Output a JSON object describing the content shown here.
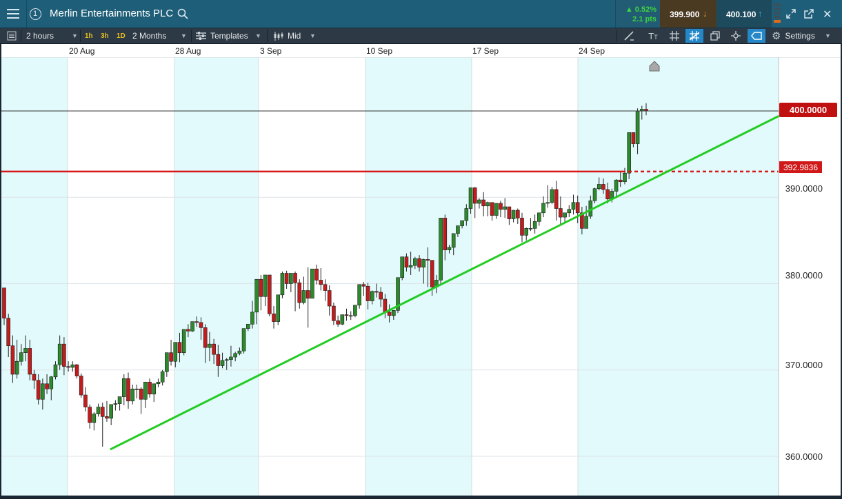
{
  "window": {
    "title": "Merlin Entertainments PLC",
    "change_pct": "▲ 0.52%",
    "change_pts": "2.1 pts",
    "sell_price": "399.900",
    "buy_price": "400.100",
    "up_color": "#3fd43f",
    "sell_color": "#e39a2c",
    "buy_color": "#2fb4e0"
  },
  "toolbar": {
    "interval": "2 hours",
    "quick_tf": [
      "1h",
      "3h",
      "1D"
    ],
    "range": "2 Months",
    "templates_label": "Templates",
    "price_mode": "Mid",
    "settings_label": "Settings",
    "icons": [
      "list-icon",
      "draw-line-icon",
      "text-tool-icon",
      "grid-icon",
      "trendline-tool-icon",
      "layers-icon",
      "crosshair-icon",
      "tag-icon",
      "gear-icon"
    ]
  },
  "chart_data": {
    "type": "candlestick",
    "title": "",
    "instrument": "Merlin Entertainments PLC",
    "xlabel": "",
    "ylabel": "",
    "date_labels": [
      "20 Aug",
      "28 Aug",
      "3 Sep",
      "10 Sep",
      "17 Sep",
      "24 Sep"
    ],
    "y_ticks": [
      360,
      370,
      380,
      390,
      400
    ],
    "y_tick_labels": [
      "360.0000",
      "370.0000",
      "380.0000",
      "390.0000"
    ],
    "ylim": [
      356.0,
      405.6
    ],
    "last_price": 400.0,
    "last_price_label": "400.0000",
    "horizontal_level": 392.9836,
    "horizontal_level_label": "392.9836",
    "trendline": {
      "from_price": 360.8,
      "to_price": 399.4,
      "color": "#22cc22"
    },
    "level_color": "#d81818",
    "up_color": "#2c8a2c",
    "down_color": "#c41c1c",
    "grid": true,
    "candles": [
      [
        379.5,
        379.5,
        376.0,
        375.2
      ],
      [
        376.0,
        376.5,
        372.8,
        371.5
      ],
      [
        372.8,
        374.0,
        369.5,
        368.5
      ],
      [
        369.5,
        373.5,
        371.0,
        369.0
      ],
      [
        371.0,
        373.0,
        372.0,
        370.5
      ],
      [
        372.0,
        374.0,
        372.5,
        371.0
      ],
      [
        372.5,
        373.5,
        369.5,
        368.8
      ],
      [
        369.5,
        370.0,
        368.8,
        367.8
      ],
      [
        368.8,
        369.5,
        366.6,
        366.0
      ],
      [
        366.6,
        369.0,
        368.4,
        365.4
      ],
      [
        368.4,
        369.5,
        367.8,
        367.2
      ],
      [
        367.8,
        369.3,
        369.2,
        366.5
      ],
      [
        369.2,
        371.0,
        370.6,
        368.9
      ],
      [
        370.6,
        374.0,
        373.0,
        370.0
      ],
      [
        373.0,
        373.8,
        370.4,
        369.4
      ],
      [
        370.4,
        371.0,
        370.3,
        369.8
      ],
      [
        370.3,
        371.0,
        370.6,
        369.8
      ],
      [
        370.6,
        370.7,
        369.3,
        369.0
      ],
      [
        369.3,
        369.6,
        367.1,
        366.8
      ],
      [
        367.1,
        368.0,
        365.7,
        365.2
      ],
      [
        365.7,
        366.0,
        363.9,
        363.2
      ],
      [
        363.9,
        365.1,
        364.9,
        363.0
      ],
      [
        364.9,
        366.1,
        365.7,
        364.6
      ],
      [
        365.7,
        366.2,
        364.6,
        361.1
      ],
      [
        364.6,
        366.4,
        364.4,
        364.0
      ],
      [
        364.4,
        365.8,
        366.0,
        363.6
      ],
      [
        366.0,
        366.5,
        366.1,
        365.3
      ],
      [
        366.1,
        366.8,
        366.9,
        365.3
      ],
      [
        366.9,
        369.5,
        369.0,
        365.9
      ],
      [
        369.0,
        369.7,
        366.4,
        365.5
      ],
      [
        366.4,
        368.3,
        367.8,
        366.0
      ],
      [
        367.8,
        368.3,
        367.8,
        366.7
      ],
      [
        367.8,
        368.0,
        366.6,
        364.9
      ],
      [
        366.6,
        368.3,
        368.6,
        365.6
      ],
      [
        368.6,
        369.0,
        367.2,
        366.8
      ],
      [
        367.2,
        368.4,
        368.4,
        366.3
      ],
      [
        368.4,
        369.0,
        368.6,
        368.0
      ],
      [
        368.6,
        370.0,
        369.8,
        368.2
      ],
      [
        369.8,
        371.3,
        372.0,
        369.2
      ],
      [
        372.0,
        373.5,
        371.0,
        370.5
      ],
      [
        371.0,
        373.1,
        373.2,
        370.3
      ],
      [
        373.2,
        374.3,
        372.0,
        370.9
      ],
      [
        372.0,
        374.1,
        374.7,
        371.7
      ],
      [
        374.7,
        375.3,
        374.5,
        373.8
      ],
      [
        374.5,
        375.2,
        375.6,
        374.4
      ],
      [
        375.6,
        376.2,
        375.5,
        375.0
      ],
      [
        375.5,
        376.1,
        374.9,
        373.5
      ],
      [
        374.9,
        375.3,
        372.6,
        370.8
      ],
      [
        372.6,
        374.4,
        373.0,
        371.0
      ],
      [
        373.0,
        373.6,
        371.8,
        370.7
      ],
      [
        371.8,
        372.9,
        370.5,
        369.2
      ],
      [
        370.5,
        372.0,
        371.1,
        370.2
      ],
      [
        371.1,
        371.4,
        371.2,
        370.0
      ],
      [
        371.2,
        372.8,
        371.5,
        370.4
      ],
      [
        371.5,
        372.1,
        371.9,
        371.0
      ],
      [
        371.9,
        372.6,
        372.2,
        371.7
      ],
      [
        372.2,
        374.1,
        374.8,
        371.9
      ],
      [
        374.8,
        375.1,
        375.3,
        374.5
      ],
      [
        375.3,
        378.0,
        376.7,
        374.8
      ],
      [
        376.7,
        378.3,
        380.5,
        375.3
      ],
      [
        380.5,
        381.0,
        378.5,
        376.9
      ],
      [
        378.5,
        380.9,
        381.0,
        377.4
      ],
      [
        381.0,
        380.7,
        376.5,
        376.2
      ],
      [
        376.5,
        377.4,
        375.6,
        374.8
      ],
      [
        375.6,
        378.5,
        378.7,
        375.2
      ],
      [
        378.7,
        381.4,
        381.2,
        378.3
      ],
      [
        381.2,
        381.5,
        380.0,
        379.4
      ],
      [
        380.0,
        380.5,
        381.2,
        379.0
      ],
      [
        381.2,
        381.4,
        380.1,
        376.8
      ],
      [
        380.1,
        380.5,
        377.8,
        377.1
      ],
      [
        377.8,
        380.8,
        379.2,
        377.6
      ],
      [
        379.2,
        381.9,
        378.3,
        374.9
      ],
      [
        378.3,
        379.3,
        381.7,
        378.5
      ],
      [
        381.7,
        382.2,
        380.4,
        379.9
      ],
      [
        380.4,
        381.8,
        379.9,
        379.2
      ],
      [
        379.9,
        380.5,
        379.2,
        378.0
      ],
      [
        379.2,
        379.8,
        377.4,
        376.3
      ],
      [
        377.4,
        377.8,
        375.7,
        375.2
      ],
      [
        375.7,
        376.3,
        375.3,
        375.0
      ],
      [
        375.3,
        376.0,
        376.4,
        375.2
      ],
      [
        376.4,
        377.1,
        376.3,
        375.7
      ],
      [
        376.3,
        376.8,
        376.3,
        375.8
      ],
      [
        376.3,
        377.5,
        377.5,
        376.1
      ],
      [
        377.5,
        379.2,
        379.9,
        377.1
      ],
      [
        379.9,
        380.2,
        379.7,
        378.6
      ],
      [
        379.7,
        380.1,
        378.0,
        377.0
      ],
      [
        378.0,
        379.2,
        379.1,
        377.6
      ],
      [
        379.1,
        380.0,
        379.0,
        378.4
      ],
      [
        379.0,
        379.6,
        378.2,
        377.3
      ],
      [
        378.2,
        378.8,
        376.7,
        376.0
      ],
      [
        376.7,
        377.6,
        376.3,
        375.5
      ],
      [
        376.3,
        376.7,
        376.9,
        375.8
      ],
      [
        376.9,
        377.7,
        380.7,
        376.6
      ],
      [
        380.7,
        383.1,
        383.1,
        380.4
      ],
      [
        383.1,
        383.5,
        381.9,
        381.4
      ],
      [
        381.9,
        383.7,
        382.1,
        381.0
      ],
      [
        382.1,
        383.1,
        382.9,
        381.7
      ],
      [
        382.9,
        383.3,
        381.9,
        381.4
      ],
      [
        381.9,
        382.9,
        382.8,
        380.0
      ],
      [
        382.8,
        384.2,
        382.7,
        379.6
      ],
      [
        382.7,
        381.7,
        379.6,
        378.6
      ],
      [
        379.6,
        381.0,
        380.4,
        378.9
      ],
      [
        380.4,
        381.9,
        387.6,
        379.9
      ],
      [
        387.6,
        388.0,
        383.9,
        382.7
      ],
      [
        383.9,
        384.5,
        384.2,
        383.5
      ],
      [
        384.2,
        385.4,
        385.8,
        383.3
      ],
      [
        385.8,
        386.5,
        386.7,
        385.4
      ],
      [
        386.7,
        387.1,
        387.3,
        386.4
      ],
      [
        387.3,
        389.2,
        388.7,
        386.7
      ],
      [
        388.7,
        390.0,
        391.1,
        388.1
      ],
      [
        391.1,
        391.2,
        389.3,
        387.6
      ],
      [
        389.3,
        389.9,
        389.7,
        388.7
      ],
      [
        389.7,
        390.6,
        389.0,
        387.8
      ],
      [
        389.0,
        389.5,
        389.4,
        387.8
      ],
      [
        389.4,
        389.2,
        387.9,
        387.3
      ],
      [
        387.9,
        388.9,
        389.3,
        387.5
      ],
      [
        389.3,
        389.6,
        388.6,
        387.7
      ],
      [
        388.6,
        389.9,
        388.9,
        387.6
      ],
      [
        388.9,
        388.7,
        387.5,
        386.8
      ],
      [
        387.5,
        388.5,
        388.5,
        387.1
      ],
      [
        388.5,
        388.7,
        387.6,
        386.9
      ],
      [
        387.6,
        388.2,
        385.6,
        384.8
      ],
      [
        385.6,
        386.5,
        386.4,
        385.0
      ],
      [
        386.4,
        387.6,
        386.4,
        386.1
      ],
      [
        386.4,
        388.0,
        387.2,
        385.8
      ],
      [
        387.2,
        387.9,
        388.2,
        386.7
      ],
      [
        388.2,
        390.1,
        389.3,
        387.7
      ],
      [
        389.3,
        391.4,
        389.4,
        388.8
      ],
      [
        389.4,
        391.2,
        390.9,
        389.2
      ],
      [
        390.9,
        391.9,
        388.7,
        387.3
      ],
      [
        388.7,
        390.1,
        387.7,
        386.9
      ],
      [
        387.7,
        388.0,
        388.2,
        387.1
      ],
      [
        388.2,
        389.1,
        388.6,
        387.7
      ],
      [
        388.6,
        390.3,
        389.4,
        388.0
      ],
      [
        389.4,
        390.2,
        388.2,
        387.0
      ],
      [
        388.2,
        388.9,
        386.4,
        385.7
      ],
      [
        386.4,
        389.0,
        387.8,
        386.5
      ],
      [
        387.8,
        390.2,
        389.6,
        387.5
      ],
      [
        389.6,
        391.1,
        391.0,
        389.3
      ],
      [
        391.0,
        392.3,
        391.5,
        390.8
      ],
      [
        391.5,
        392.2,
        390.9,
        390.4
      ],
      [
        390.9,
        391.7,
        389.8,
        389.3
      ],
      [
        389.8,
        391.0,
        390.7,
        389.4
      ],
      [
        390.7,
        392.1,
        392.0,
        389.9
      ],
      [
        392.0,
        393.0,
        391.8,
        391.2
      ],
      [
        391.8,
        393.4,
        392.8,
        391.5
      ],
      [
        392.8,
        395.3,
        397.5,
        392.1
      ],
      [
        397.5,
        397.3,
        396.2,
        395.8
      ],
      [
        396.2,
        400.3,
        400.0,
        395.0
      ],
      [
        400.0,
        400.6,
        400.2,
        399.0
      ],
      [
        400.2,
        400.9,
        400.0,
        399.5
      ]
    ]
  }
}
